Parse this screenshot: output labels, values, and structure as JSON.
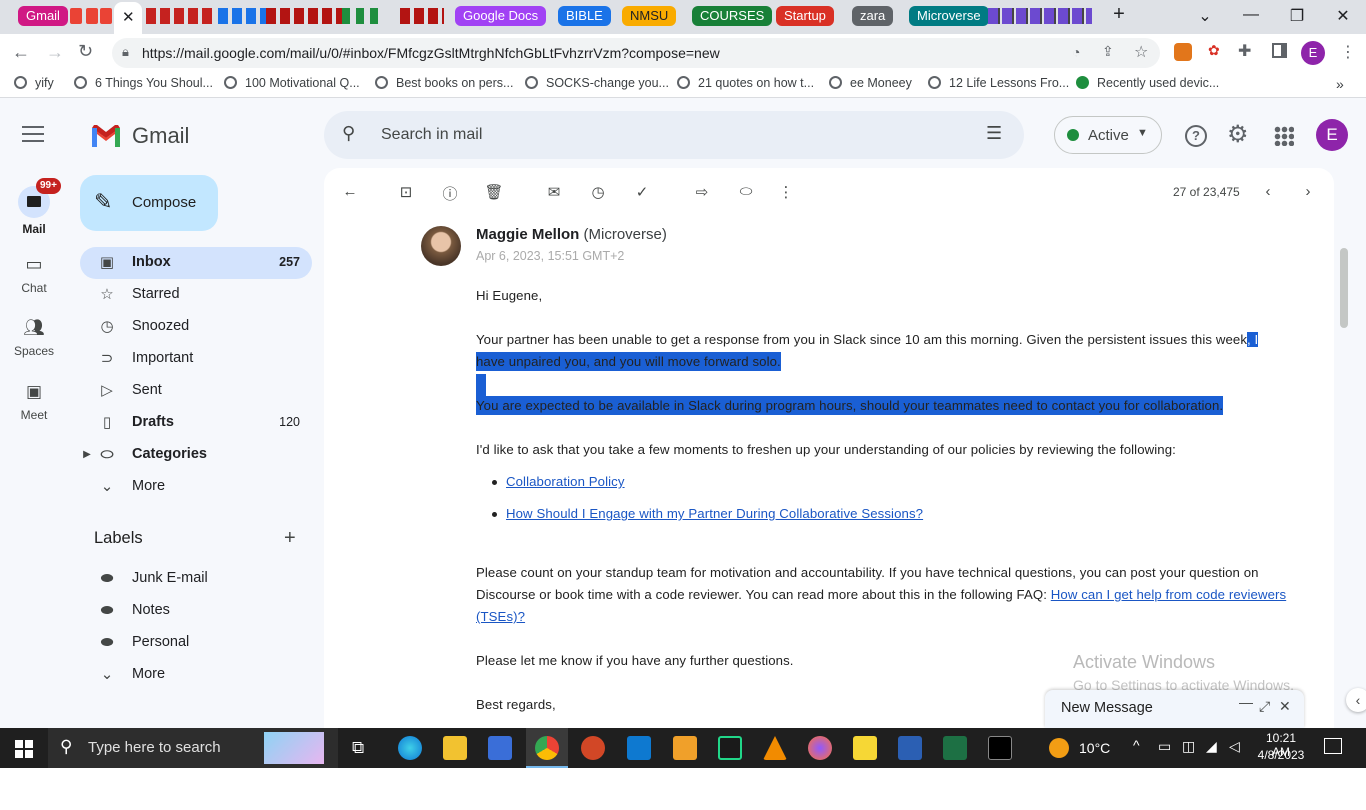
{
  "browser": {
    "tab_groups": [
      "Gmail",
      "Google Docs",
      "BIBLE",
      "NMSU",
      "COURSES",
      "Startup",
      "zara",
      "Microverse"
    ],
    "group_colors": [
      "#d01884",
      "#a142f4",
      "#1a73e8",
      "#f9ab00",
      "#188038",
      "#d93025",
      "#5f6368",
      "#007b83"
    ],
    "url": "https://mail.google.com/mail/u/0/#inbox/FMfcgzGsltMtrghNfchGbLtFvhzrrVzm?compose=new",
    "profile_initial": "E",
    "bookmarks": [
      "yify",
      "6 Things You Shoul...",
      "100 Motivational Q...",
      "Best books on pers...",
      "SOCKS-change you...",
      "21 quotes on how t...",
      "ee Moneey",
      "12 Life Lessons Fro...",
      "Recently used devic..."
    ]
  },
  "gmail": {
    "logo_text": "Gmail",
    "search_placeholder": "Search in mail",
    "status": "Active",
    "avatar": "E",
    "compose_label": "Compose",
    "rail": [
      {
        "label": "Mail",
        "badge": "99+"
      },
      {
        "label": "Chat"
      },
      {
        "label": "Spaces"
      },
      {
        "label": "Meet"
      }
    ],
    "nav": [
      {
        "label": "Inbox",
        "count": "257",
        "icon": "inbox-icon"
      },
      {
        "label": "Starred",
        "count": "",
        "icon": "star-icon"
      },
      {
        "label": "Snoozed",
        "count": "",
        "icon": "clock-icon"
      },
      {
        "label": "Important",
        "count": "",
        "icon": "important-icon"
      },
      {
        "label": "Sent",
        "count": "",
        "icon": "send-icon"
      },
      {
        "label": "Drafts",
        "count": "120",
        "icon": "draft-icon"
      },
      {
        "label": "Categories",
        "count": "",
        "icon": "caret-icon"
      },
      {
        "label": "More",
        "count": "",
        "icon": "chevron-down-icon"
      }
    ],
    "labels_title": "Labels",
    "labels": [
      "Junk E-mail",
      "Notes",
      "Personal",
      "More"
    ],
    "pager": "27 of 23,475"
  },
  "email": {
    "sender_name": "Maggie Mellon",
    "sender_org": "(Microverse)",
    "date": "Apr 6, 2023, 15:51 GMT+2",
    "greeting": "Hi Eugene,",
    "p1a": "Your partner has been unable to get a response from you in Slack since 10 am this morning. Given the persistent issues this week",
    "p1b": ", I",
    "p1c": "have unpaired you, and you will move forward solo.",
    "p2": "You are expected to be available in Slack during program hours, should your teammates need to contact you for collaboration.",
    "p3": "I'd like to ask that you take a few moments to freshen up your understanding of our policies by reviewing the following:",
    "links": [
      "Collaboration Policy",
      "How Should I Engage with my Partner During Collaborative Sessions?"
    ],
    "p4a": "Please count on your standup team for motivation and accountability. If you have technical questions, you can post your question on",
    "p4b": "Discourse or book time with a code reviewer. You can read more about this in the following FAQ: ",
    "p4link1": "How can I get help from code reviewers",
    "p4link2": "(TSEs)?",
    "p5": "Please let me know if you have any further questions.",
    "p6": "Best regards,"
  },
  "watermark": {
    "title": "Activate Windows",
    "sub": "Go to Settings to activate Windows."
  },
  "compose_window": {
    "title": "New Message"
  },
  "taskbar": {
    "search_placeholder": "Type here to search",
    "weather": "10°C",
    "time": "10:21 AM",
    "date": "4/8/2023"
  }
}
